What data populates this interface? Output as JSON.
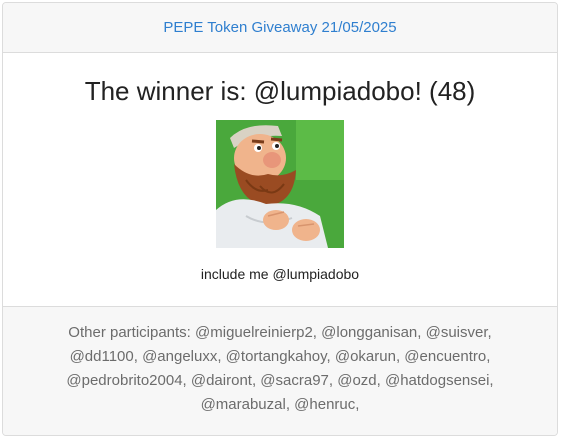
{
  "header": {
    "title": "PEPE Token Giveaway 21/05/2025"
  },
  "winner": {
    "heading": "The winner is: @lumpiadobo! (48)",
    "avatar_icon": "bearded-man-avatar",
    "comment": "include me @lumpiadobo"
  },
  "footer": {
    "participants_text": "Other participants: @miguelreinierp2, @longganisan, @suisver, @dd1100, @angeluxx, @tortangkahoy, @okarun, @encuentro, @pedrobrito2004, @dairont, @sacra97, @ozd, @hatdogsensei, @marabuzal, @henruc,"
  },
  "colors": {
    "link": "#2f7fcf",
    "header_bg": "#f7f7f7",
    "border": "#dcdcdc",
    "muted_text": "#6c6c6c",
    "avatar_bg": "#4aa83c"
  }
}
